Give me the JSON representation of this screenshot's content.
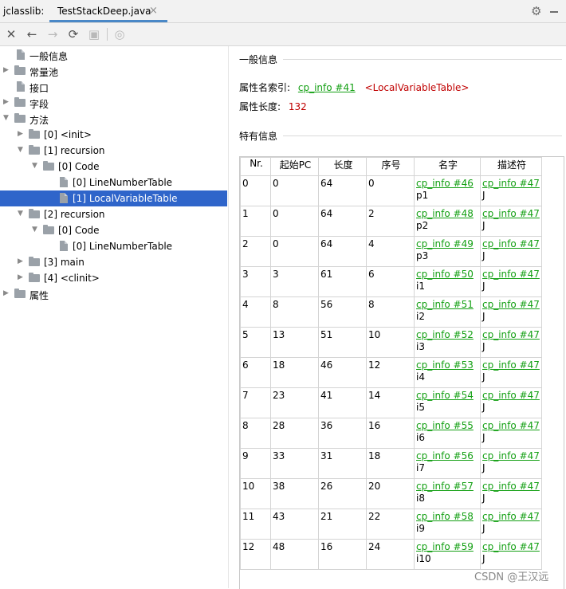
{
  "tabbar": {
    "tool_name": "jclasslib:",
    "tab_label": "TestStackDeep.java",
    "close_glyph": "×"
  },
  "toolbar": {
    "buttons": [
      {
        "name": "close-icon",
        "glyph": "✕"
      },
      {
        "name": "back-icon",
        "glyph": "←"
      },
      {
        "name": "forward-icon",
        "glyph": "→"
      },
      {
        "name": "refresh-icon",
        "glyph": "⟳"
      },
      {
        "name": "save-icon",
        "glyph": "▣"
      },
      {
        "name": "web-icon",
        "glyph": "◎"
      }
    ]
  },
  "tree": {
    "items": [
      {
        "label": "一般信息"
      },
      {
        "label": "常量池"
      },
      {
        "label": "接口"
      },
      {
        "label": "字段"
      },
      {
        "label": "方法"
      },
      {
        "label": "[0] <init>"
      },
      {
        "label": "[1] recursion"
      },
      {
        "label": "[0] Code"
      },
      {
        "label": "[0] LineNumberTable"
      },
      {
        "label": "[1] LocalVariableTable"
      },
      {
        "label": "[2] recursion"
      },
      {
        "label": "[0] Code"
      },
      {
        "label": "[0] LineNumberTable"
      },
      {
        "label": "[3] main"
      },
      {
        "label": "[4] <clinit>"
      },
      {
        "label": "属性"
      }
    ]
  },
  "general": {
    "title": "一般信息",
    "attr_name_label": "属性名索引:",
    "attr_name_link": "cp_info #41",
    "attr_name_value": "<LocalVariableTable>",
    "attr_len_label": "属性长度:",
    "attr_len_value": "132"
  },
  "specific": {
    "title": "特有信息",
    "columns": [
      "Nr.",
      "起始PC",
      "长度",
      "序号",
      "名字",
      "描述符"
    ],
    "rows": [
      {
        "nr": "0",
        "start": "0",
        "len": "64",
        "idx": "0",
        "name_link": "cp_info #46",
        "name": "p1",
        "desc_link": "cp_info #47",
        "desc": "J"
      },
      {
        "nr": "1",
        "start": "0",
        "len": "64",
        "idx": "2",
        "name_link": "cp_info #48",
        "name": "p2",
        "desc_link": "cp_info #47",
        "desc": "J"
      },
      {
        "nr": "2",
        "start": "0",
        "len": "64",
        "idx": "4",
        "name_link": "cp_info #49",
        "name": "p3",
        "desc_link": "cp_info #47",
        "desc": "J"
      },
      {
        "nr": "3",
        "start": "3",
        "len": "61",
        "idx": "6",
        "name_link": "cp_info #50",
        "name": "i1",
        "desc_link": "cp_info #47",
        "desc": "J"
      },
      {
        "nr": "4",
        "start": "8",
        "len": "56",
        "idx": "8",
        "name_link": "cp_info #51",
        "name": "i2",
        "desc_link": "cp_info #47",
        "desc": "J"
      },
      {
        "nr": "5",
        "start": "13",
        "len": "51",
        "idx": "10",
        "name_link": "cp_info #52",
        "name": "i3",
        "desc_link": "cp_info #47",
        "desc": "J"
      },
      {
        "nr": "6",
        "start": "18",
        "len": "46",
        "idx": "12",
        "name_link": "cp_info #53",
        "name": "i4",
        "desc_link": "cp_info #47",
        "desc": "J"
      },
      {
        "nr": "7",
        "start": "23",
        "len": "41",
        "idx": "14",
        "name_link": "cp_info #54",
        "name": "i5",
        "desc_link": "cp_info #47",
        "desc": "J"
      },
      {
        "nr": "8",
        "start": "28",
        "len": "36",
        "idx": "16",
        "name_link": "cp_info #55",
        "name": "i6",
        "desc_link": "cp_info #47",
        "desc": "J"
      },
      {
        "nr": "9",
        "start": "33",
        "len": "31",
        "idx": "18",
        "name_link": "cp_info #56",
        "name": "i7",
        "desc_link": "cp_info #47",
        "desc": "J"
      },
      {
        "nr": "10",
        "start": "38",
        "len": "26",
        "idx": "20",
        "name_link": "cp_info #57",
        "name": "i8",
        "desc_link": "cp_info #47",
        "desc": "J"
      },
      {
        "nr": "11",
        "start": "43",
        "len": "21",
        "idx": "22",
        "name_link": "cp_info #58",
        "name": "i9",
        "desc_link": "cp_info #47",
        "desc": "J"
      },
      {
        "nr": "12",
        "start": "48",
        "len": "16",
        "idx": "24",
        "name_link": "cp_info #59",
        "name": "i10",
        "desc_link": "cp_info #47",
        "desc": "J"
      }
    ]
  },
  "watermark": "CSDN @王汉远",
  "colors": {
    "selection": "#2f65ca",
    "link": "#14a014",
    "accent_red": "#c00000",
    "tab_underline": "#4a88c7"
  }
}
